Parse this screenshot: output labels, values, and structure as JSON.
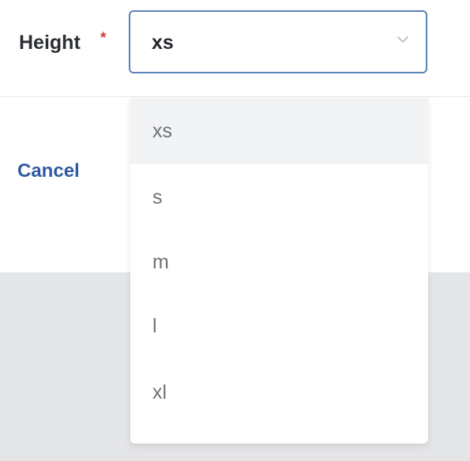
{
  "form": {
    "height_label": "Height",
    "required_marker": "*",
    "height_select": {
      "selected_value": "xs",
      "expanded": true,
      "options": [
        "xs",
        "s",
        "m",
        "l",
        "xl"
      ]
    },
    "cancel_label": "Cancel"
  },
  "icons": {
    "select_toggle": "chevron-down-icon"
  },
  "colors": {
    "focus_border": "#5b82b8",
    "required": "#d23b3b",
    "link": "#2f5aa0",
    "option_hover": "#f2f3f5",
    "overlay": "#e4e5e7"
  }
}
